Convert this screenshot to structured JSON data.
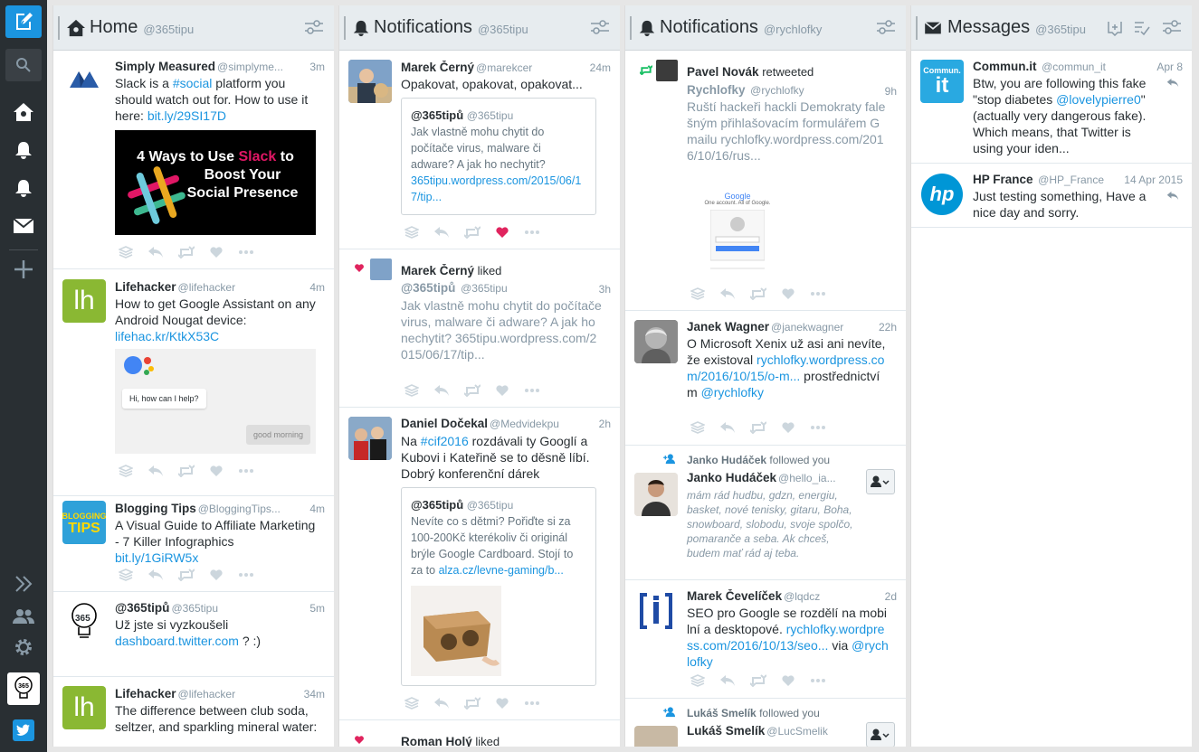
{
  "nav": {
    "items": [
      "compose",
      "search",
      "home",
      "notifications-1",
      "notifications-2",
      "messages",
      "add-column"
    ],
    "bottom": [
      "expand",
      "accounts",
      "settings",
      "account-avatar",
      "twitter"
    ]
  },
  "columns": [
    {
      "number": "1",
      "title": "Home",
      "account": "@365tipu",
      "tweets": [
        {
          "name": "Simply Measured",
          "handle": "@simplyme...",
          "time": "3m",
          "text_a": "Slack is a ",
          "hashtag": "#social",
          "text_b": " platform you should watch out for. How to use it here: ",
          "link": "bit.ly/29SI17D",
          "image_text": [
            "4 Ways to Use ",
            "Slack",
            " to",
            "Boost Your",
            "Social Presence"
          ]
        },
        {
          "name": "Lifehacker",
          "handle": "@lifehacker",
          "time": "4m",
          "text": "How to get Google Assistant on any Android Nougat device:",
          "link": "lifehac.kr/KtkX53C",
          "card_bubble": "Hi, how can I help?",
          "card_reply": "good morning",
          "avatar_text": "lh"
        },
        {
          "name": "Blogging Tips",
          "handle": "@BloggingTips...",
          "time": "4m",
          "text": "A Visual Guide to Affiliate Marketing - 7 Killer Infographics",
          "link": "bit.ly/1GiRW5x",
          "avatar_text": [
            "BLOGGING",
            "TIPS"
          ]
        },
        {
          "name": "@365tipů",
          "handle": "@365tipu",
          "time": "5m",
          "text": "Už jste si vyzkoušeli",
          "link": "dashboard.twitter.com",
          "text_b": " ? :)",
          "avatar_text": "365"
        },
        {
          "name": "Lifehacker",
          "handle": "@lifehacker",
          "time": "34m",
          "text": "The difference between club soda, seltzer, and sparkling mineral water:",
          "avatar_text": "lh"
        }
      ]
    },
    {
      "number": "2",
      "title": "Notifications",
      "account": "@365tipu",
      "items": [
        {
          "name": "Marek Černý",
          "handle": "@marekcer",
          "time": "24m",
          "text": "Opakovat, opakovat, opakovat...",
          "quote": {
            "name": "@365tipů",
            "handle": "@365tipu",
            "text": "Jak vlastně mohu chytit do počítače virus, malware či adware? A jak ho nechytit?",
            "link": "365tipu.wordpress.com/2015/06/17/tip..."
          }
        },
        {
          "liker": "Marek Černý",
          "liked": "liked",
          "name": "@365tipů",
          "handle": "@365tipu",
          "time": "3h",
          "text": "Jak vlastně mohu chytit do počítače virus, malware či adware? A jak ho nechytit? 365tipu.wordpress.com/2015/06/17/tip..."
        },
        {
          "name": "Daniel Dočekal",
          "handle": "@Medvidekpu",
          "time": "2h",
          "text_a": "Na ",
          "hashtag": "#cif2016",
          "text_b": " rozdávali ty Googlí a Kubovi i Kateřině se to děsně líbí. Dobrý konferenční dárek",
          "quote": {
            "name": "@365tipů",
            "handle": "@365tipu",
            "text": "Nevíte co s dětmi? Pořiďte si za 100-200Kč kterékoliv či originál brýle Google Cardboard. Stojí to za to ",
            "link": "alza.cz/levne-gaming/b..."
          }
        },
        {
          "liker": "Roman Holý",
          "liked": "liked"
        }
      ]
    },
    {
      "number": "3",
      "title": "Notifications",
      "account": "@rychlofky",
      "items": [
        {
          "retweeter": "Pavel Novák",
          "retweeted": "retweeted",
          "name": "Rychlofky",
          "handle": "@rychlofky",
          "time": "9h",
          "text": "Ruští hackeři hackli Demokraty falešným přihlašovacím formulářem Gmailu rychlofky.wordpress.com/2016/10/16/rus...",
          "shot_title": "Google",
          "shot_sub": "One account. All of Google."
        },
        {
          "name": "Janek Wagner",
          "handle": "@janekwagner",
          "time": "22h",
          "text": "O Microsoft Xenix už asi ani nevíte, že existoval",
          "link": "rychlofky.wordpress.com/2016/10/15/o-m...",
          "text_b": " prostřednictvím ",
          "mention": "@rychlofky"
        },
        {
          "follower": "Janko Hudáček",
          "followed": "followed you",
          "name": "Janko Hudáček",
          "handle": "@hello_ia...",
          "bio": "mám rád hudbu, gdzn, energiu, basket, nové tenisky, gitaru, Boha, snowboard, slobodu, svoje spolčo, pomarančе a seba. Ak chceš, budem mať rád aj teba."
        },
        {
          "name": "Marek Čevelíček",
          "handle": "@lqdcz",
          "time": "2d",
          "text": "SEO pro Google se rozdělí na mobilní a desktopové.",
          "link": "rychlofky.wordpress.com/2016/10/13/seo...",
          "text_b": " via ",
          "mention": "@rychlofky"
        },
        {
          "follower": "Lukáš Smelík",
          "followed": "followed you",
          "name": "Lukáš Smelík",
          "handle": "@LucSmelik"
        }
      ]
    },
    {
      "number": "4",
      "title": "Messages",
      "account": "@365tipu",
      "messages": [
        {
          "name": "Commun.it",
          "handle": "@commun_it",
          "time": "Apr 8",
          "text_a": "Btw, you are following this fake \"stop diabetes ",
          "mention": "@lovelypierre0",
          "text_b": "\" (actually very dangerous fake). Which means, that Twitter is using your iden...",
          "avatar_top": "Commun.",
          "avatar_main": "it"
        },
        {
          "name": "HP France",
          "handle": "@HP_France",
          "time": "14 Apr 2015",
          "text": "Just testing something, Have a nice day and sorry.",
          "avatar_text": "hp"
        }
      ]
    }
  ],
  "colors": {
    "accent": "#1b95e0",
    "nav_bg": "#292f33",
    "like": "#e0245e",
    "retweet": "#17bf63"
  }
}
